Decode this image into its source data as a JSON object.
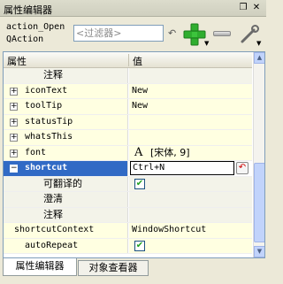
{
  "panel": {
    "title": "属性编辑器",
    "float_icon": "restore-icon",
    "close_icon": "close-icon"
  },
  "toolbar": {
    "object_name_line1": "action_Open",
    "object_name_line2": "QAction",
    "filter_placeholder": "<过滤器>",
    "add_icon": "plus-icon",
    "remove_icon": "minus-icon",
    "config_icon": "wrench-icon"
  },
  "table": {
    "headers": {
      "property": "属性",
      "value": "值"
    },
    "rows": [
      {
        "name": "注释",
        "value": "",
        "kind": "sub"
      },
      {
        "name": "iconText",
        "value": "New",
        "kind": "group"
      },
      {
        "name": "toolTip",
        "value": "New",
        "kind": "group"
      },
      {
        "name": "statusTip",
        "value": "",
        "kind": "group"
      },
      {
        "name": "whatsThis",
        "value": "",
        "kind": "group"
      },
      {
        "name": "font",
        "value": "[宋体, 9]",
        "kind": "group-font"
      },
      {
        "name": "shortcut",
        "value": "Ctrl+N",
        "kind": "selected"
      },
      {
        "name": "可翻译的",
        "value": "checked",
        "kind": "sub-check"
      },
      {
        "name": "澄清",
        "value": "",
        "kind": "sub"
      },
      {
        "name": "注释",
        "value": "",
        "kind": "sub"
      },
      {
        "name": "shortcutContext",
        "value": "WindowShortcut",
        "kind": "plain"
      },
      {
        "name": "autoRepeat",
        "value": "checked",
        "kind": "plain-check"
      }
    ]
  },
  "tabs": [
    {
      "label": "属性编辑器",
      "active": true
    },
    {
      "label": "对象查看器",
      "active": false
    }
  ],
  "colors": {
    "selection": "#316ac5",
    "group_row": "#ffffe1",
    "panel_bg": "#ece9d8"
  }
}
